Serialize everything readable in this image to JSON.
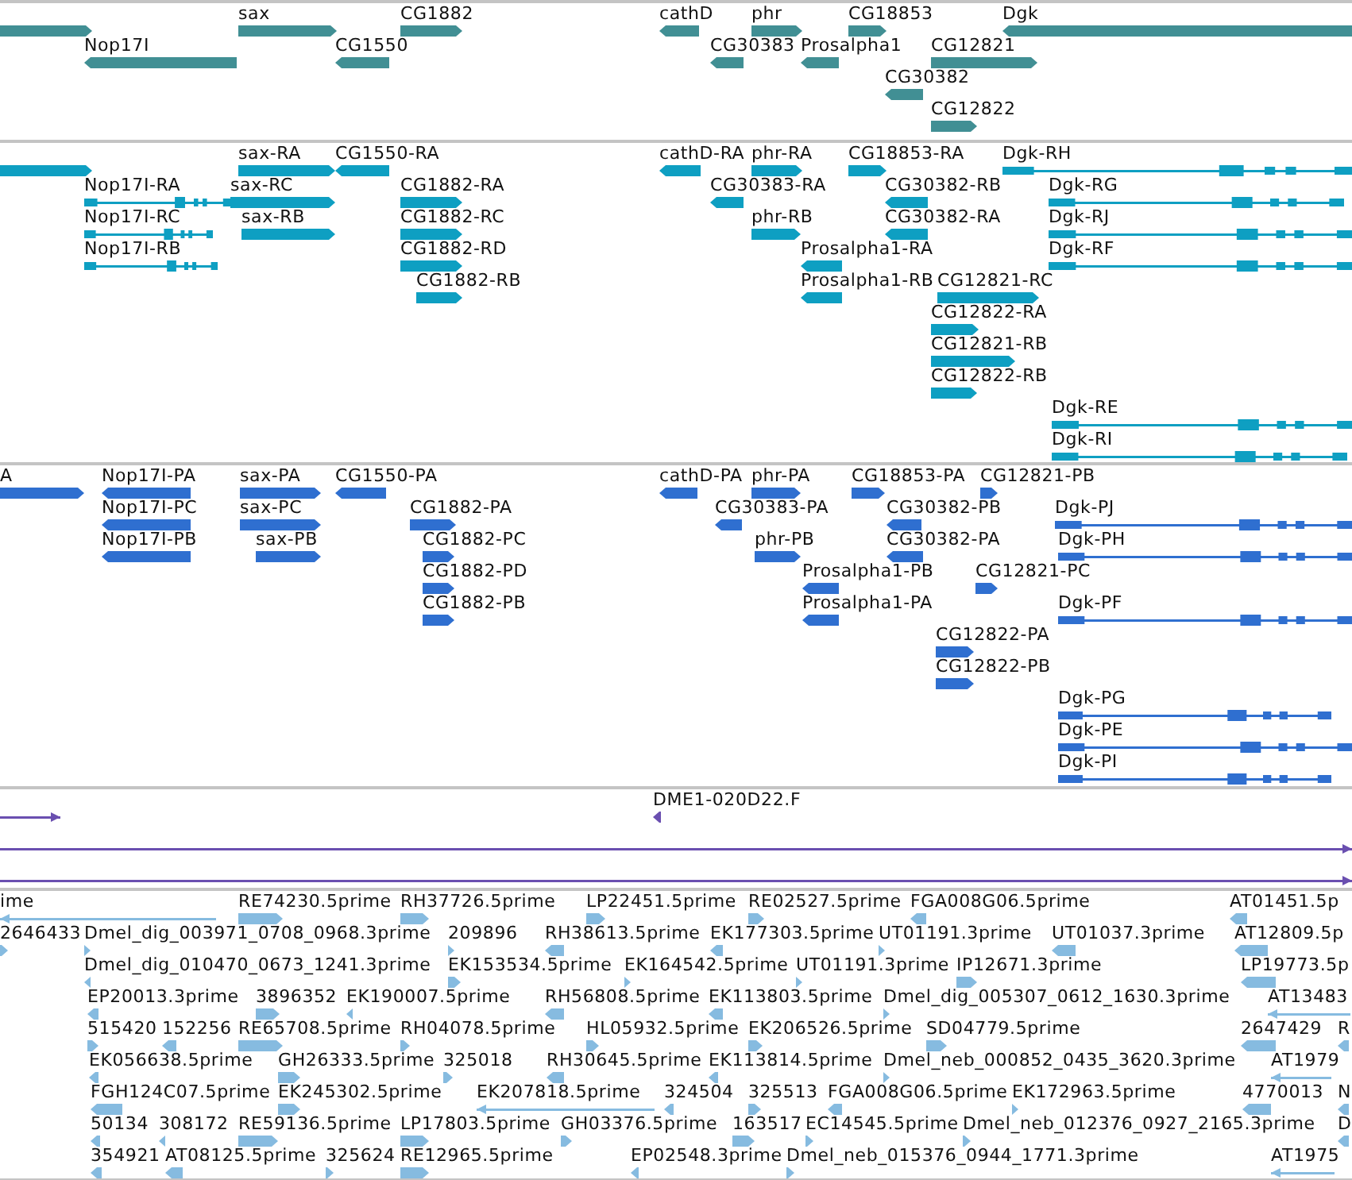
{
  "tracks": [
    {
      "kind": "gene",
      "color": "#418f94",
      "features": [
        {
          "kind": "forward"
        },
        {
          "label": "sax",
          "kind": "forward"
        },
        {
          "label": "CG1882",
          "kind": "forward"
        },
        {
          "label": "cathD",
          "kind": "reverse"
        },
        {
          "label": "phr",
          "kind": "forward"
        },
        {
          "label": "CG18853",
          "kind": "forward"
        },
        {
          "label": "Dgk",
          "kind": "reverse"
        },
        {
          "label": "Nop17I",
          "kind": "reverse"
        },
        {
          "label": "CG1550",
          "kind": "reverse"
        },
        {
          "label": "CG30383",
          "kind": "reverse"
        },
        {
          "label": "Prosalpha1",
          "kind": "reverse"
        },
        {
          "label": "CG12821",
          "kind": "forward"
        },
        {
          "label": "CG30382",
          "kind": "reverse"
        },
        {
          "label": "CG12822",
          "kind": "forward"
        }
      ]
    },
    {
      "kind": "transcript",
      "color": "#0e9fc2",
      "features": [
        {
          "kind": "forward"
        },
        {
          "label": "sax-RA",
          "kind": "forward"
        },
        {
          "label": "CG1550-RA",
          "kind": "reverse"
        },
        {
          "label": "cathD-RA",
          "kind": "reverse"
        },
        {
          "label": "phr-RA",
          "kind": "forward"
        },
        {
          "label": "CG18853-RA",
          "kind": "forward"
        },
        {
          "label": "Dgk-RH",
          "kind": "reverse"
        },
        {
          "label": "Nop17I-RA",
          "kind": "reverse"
        },
        {
          "label": "sax-RC",
          "kind": "forward"
        },
        {
          "label": "CG1882-RA",
          "kind": "forward"
        },
        {
          "label": "CG30383-RA",
          "kind": "reverse"
        },
        {
          "label": "CG30382-RB",
          "kind": "reverse"
        },
        {
          "label": "Dgk-RG",
          "kind": "reverse"
        },
        {
          "label": "Nop17I-RC",
          "kind": "reverse"
        },
        {
          "label": "sax-RB",
          "kind": "forward"
        },
        {
          "label": "CG1882-RC",
          "kind": "forward"
        },
        {
          "label": "phr-RB",
          "kind": "forward"
        },
        {
          "label": "CG30382-RA",
          "kind": "reverse"
        },
        {
          "label": "Dgk-RJ",
          "kind": "reverse"
        },
        {
          "label": "Nop17I-RB",
          "kind": "reverse"
        },
        {
          "label": "CG1882-RD",
          "kind": "forward"
        },
        {
          "label": "Prosalpha1-RA",
          "kind": "reverse"
        },
        {
          "label": "Dgk-RF",
          "kind": "reverse"
        },
        {
          "label": "CG1882-RB",
          "kind": "forward"
        },
        {
          "label": "Prosalpha1-RB",
          "kind": "reverse"
        },
        {
          "label": "CG12821-RC",
          "kind": "forward"
        },
        {
          "label": "CG12822-RA",
          "kind": "forward"
        },
        {
          "label": "CG12821-RB",
          "kind": "forward"
        },
        {
          "label": "CG12822-RB",
          "kind": "forward"
        },
        {
          "label": "Dgk-RE",
          "kind": "reverse"
        },
        {
          "label": "Dgk-RI",
          "kind": "reverse"
        }
      ]
    },
    {
      "kind": "protein",
      "color": "#2f6fd0",
      "features": [
        {
          "label": "A",
          "kind": "forward"
        },
        {
          "label": "Nop17I-PA",
          "kind": "reverse"
        },
        {
          "label": "sax-PA",
          "kind": "forward"
        },
        {
          "label": "CG1550-PA",
          "kind": "reverse"
        },
        {
          "label": "cathD-PA",
          "kind": "reverse"
        },
        {
          "label": "phr-PA",
          "kind": "forward"
        },
        {
          "label": "CG18853-PA",
          "kind": "forward"
        },
        {
          "label": "CG12821-PB",
          "kind": "forward"
        },
        {
          "label": "Nop17I-PC",
          "kind": "reverse"
        },
        {
          "label": "sax-PC",
          "kind": "forward"
        },
        {
          "label": "CG1882-PA",
          "kind": "forward"
        },
        {
          "label": "CG30383-PA",
          "kind": "reverse"
        },
        {
          "label": "CG30382-PB",
          "kind": "reverse"
        },
        {
          "label": "Dgk-PJ",
          "kind": "reverse"
        },
        {
          "label": "Nop17I-PB",
          "kind": "reverse"
        },
        {
          "label": "sax-PB",
          "kind": "forward"
        },
        {
          "label": "CG1882-PC",
          "kind": "forward"
        },
        {
          "label": "phr-PB",
          "kind": "forward"
        },
        {
          "label": "CG30382-PA",
          "kind": "reverse"
        },
        {
          "label": "Dgk-PH",
          "kind": "reverse"
        },
        {
          "label": "CG1882-PD",
          "kind": "forward"
        },
        {
          "label": "Prosalpha1-PB",
          "kind": "reverse"
        },
        {
          "label": "CG12821-PC",
          "kind": "forward"
        },
        {
          "label": "CG1882-PB",
          "kind": "forward"
        },
        {
          "label": "Prosalpha1-PA",
          "kind": "reverse"
        },
        {
          "label": "Dgk-PF",
          "kind": "reverse"
        },
        {
          "label": "CG12822-PA",
          "kind": "forward"
        },
        {
          "label": "CG12822-PB",
          "kind": "forward"
        },
        {
          "label": "Dgk-PG",
          "kind": "reverse"
        },
        {
          "label": "Dgk-PE",
          "kind": "reverse"
        },
        {
          "label": "Dgk-PI",
          "kind": "reverse"
        }
      ]
    },
    {
      "kind": "clone",
      "color": "#6a4fb0",
      "features": [
        {
          "kind": "forward"
        },
        {
          "label": "DME1-020D22.F",
          "kind": "reverse"
        },
        {
          "kind": "forward"
        },
        {
          "kind": "forward"
        }
      ]
    },
    {
      "kind": "est",
      "color": "#86bbe0",
      "features": [
        {
          "label": "ime",
          "kind": "reverse"
        },
        {
          "label": "RE74230.5prime",
          "kind": "forward"
        },
        {
          "label": "RH37726.5prime",
          "kind": "forward"
        },
        {
          "label": "LP22451.5prime",
          "kind": "forward"
        },
        {
          "label": "RE02527.5prime",
          "kind": "forward"
        },
        {
          "label": "FGA008G06.5prime",
          "kind": "reverse"
        },
        {
          "label": "AT01451.5p",
          "kind": "reverse"
        },
        {
          "label": "2646433",
          "kind": "forward"
        },
        {
          "label": "Dmel_dig_003971_0708_0968.3prime",
          "kind": "forward"
        },
        {
          "label": "209896",
          "kind": "forward"
        },
        {
          "label": "RH38613.5prime",
          "kind": "reverse"
        },
        {
          "label": "EK177303.5prime",
          "kind": "reverse"
        },
        {
          "label": "UT01191.3prime",
          "kind": "forward"
        },
        {
          "label": "UT01037.3prime",
          "kind": "reverse"
        },
        {
          "label": "AT12809.5p",
          "kind": "reverse"
        },
        {
          "label": "Dmel_dig_010470_0673_1241.3prime",
          "kind": "reverse"
        },
        {
          "label": "EK153534.5prime",
          "kind": "forward"
        },
        {
          "label": "EK164542.5prime",
          "kind": "forward"
        },
        {
          "label": "UT01191.3prime",
          "kind": "forward"
        },
        {
          "label": "IP12671.3prime",
          "kind": "forward"
        },
        {
          "label": "LP19773.5p",
          "kind": "reverse"
        },
        {
          "label": "EP20013.3prime",
          "kind": "reverse"
        },
        {
          "label": "3896352",
          "kind": "forward"
        },
        {
          "label": "EK190007.5prime",
          "kind": "reverse"
        },
        {
          "label": "RH56808.5prime",
          "kind": "reverse"
        },
        {
          "label": "EK113803.5prime",
          "kind": "reverse"
        },
        {
          "label": "Dmel_dig_005307_0612_1630.3prime",
          "kind": "forward"
        },
        {
          "label": "AT13483",
          "kind": "reverse"
        },
        {
          "label": "515420",
          "kind": "forward"
        },
        {
          "label": "152256",
          "kind": "reverse"
        },
        {
          "label": "RE65708.5prime",
          "kind": "forward"
        },
        {
          "label": "RH04078.5prime",
          "kind": "forward"
        },
        {
          "label": "HL05932.5prime",
          "kind": "forward"
        },
        {
          "label": "EK206526.5prime",
          "kind": "forward"
        },
        {
          "label": "SD04779.5prime",
          "kind": "forward"
        },
        {
          "label": "2647429",
          "kind": "reverse"
        },
        {
          "label": "R",
          "kind": "reverse"
        },
        {
          "label": "EK056638.5prime",
          "kind": "reverse"
        },
        {
          "label": "GH26333.5prime",
          "kind": "forward"
        },
        {
          "label": "325018",
          "kind": "forward"
        },
        {
          "label": "RH30645.5prime",
          "kind": "reverse"
        },
        {
          "label": "EK113814.5prime",
          "kind": "reverse"
        },
        {
          "label": "Dmel_neb_000852_0435_3620.3prime",
          "kind": "forward"
        },
        {
          "label": "AT1979",
          "kind": "reverse"
        },
        {
          "label": "FGH124C07.5prime",
          "kind": "reverse"
        },
        {
          "label": "EK245302.5prime",
          "kind": "forward"
        },
        {
          "label": "EK207818.5prime",
          "kind": "reverse"
        },
        {
          "label": "324504",
          "kind": "reverse"
        },
        {
          "label": "325513",
          "kind": "forward"
        },
        {
          "label": "FGA008G06.5prime",
          "kind": "reverse"
        },
        {
          "label": "EK172963.5prime",
          "kind": "forward"
        },
        {
          "label": "4770013",
          "kind": "reverse"
        },
        {
          "label": "N",
          "kind": "reverse"
        },
        {
          "label": "50134",
          "kind": "reverse"
        },
        {
          "label": "308172",
          "kind": "reverse"
        },
        {
          "label": "RE59136.5prime",
          "kind": "forward"
        },
        {
          "label": "LP17803.5prime",
          "kind": "forward"
        },
        {
          "label": "GH03376.5prime",
          "kind": "forward"
        },
        {
          "label": "163517",
          "kind": "forward"
        },
        {
          "label": "EC14545.5prime",
          "kind": "forward"
        },
        {
          "label": "Dmel_neb_012376_0927_2165.3prime",
          "kind": "forward"
        },
        {
          "label": "D",
          "kind": "reverse"
        },
        {
          "label": "354921",
          "kind": "reverse"
        },
        {
          "label": "AT08125.5prime",
          "kind": "reverse"
        },
        {
          "label": "325624",
          "kind": "forward"
        },
        {
          "label": "RE12965.5prime",
          "kind": "forward"
        },
        {
          "label": "EP02548.3prime",
          "kind": "reverse"
        },
        {
          "label": "Dmel_neb_015376_0944_1771.3prime",
          "kind": "forward"
        },
        {
          "label": "AT1975",
          "kind": "reverse"
        }
      ]
    }
  ]
}
